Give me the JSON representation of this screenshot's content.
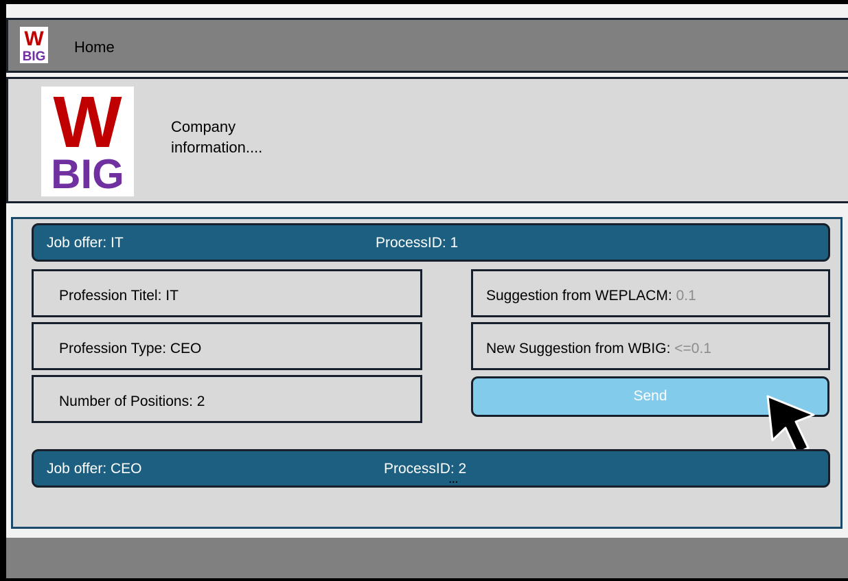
{
  "header": {
    "home_label": "Home",
    "logo_text_top": "W",
    "logo_text_bottom": "BIG"
  },
  "company": {
    "info": "Company information....",
    "logo_text_top": "W",
    "logo_text_bottom": "BIG"
  },
  "jobs": [
    {
      "title": "Job offer: IT",
      "process": "ProcessID: 1",
      "fields": {
        "profession_title": "Profession Titel: IT",
        "profession_type": "Profession Type: CEO",
        "positions": "Number of Positions: 2"
      },
      "suggestion": {
        "label": "Suggestion from WEPLACM:",
        "value": "0.1"
      },
      "new_suggestion": {
        "label": "New Suggestion from WBIG:",
        "value": "<=0.1"
      },
      "send_label": "Send"
    },
    {
      "title": "Job offer: CEO",
      "process": "ProcessID: 2"
    }
  ],
  "more_indicator": "...",
  "colors": {
    "logo_red": "#c00000",
    "logo_purple": "#7030a0",
    "job_bar": "#1c5f80",
    "send_button": "#83cbeb",
    "header_bar": "#808080",
    "panel_bg": "#d9d9d9"
  },
  "icons": {
    "cursor": "mouse-pointer-icon"
  }
}
